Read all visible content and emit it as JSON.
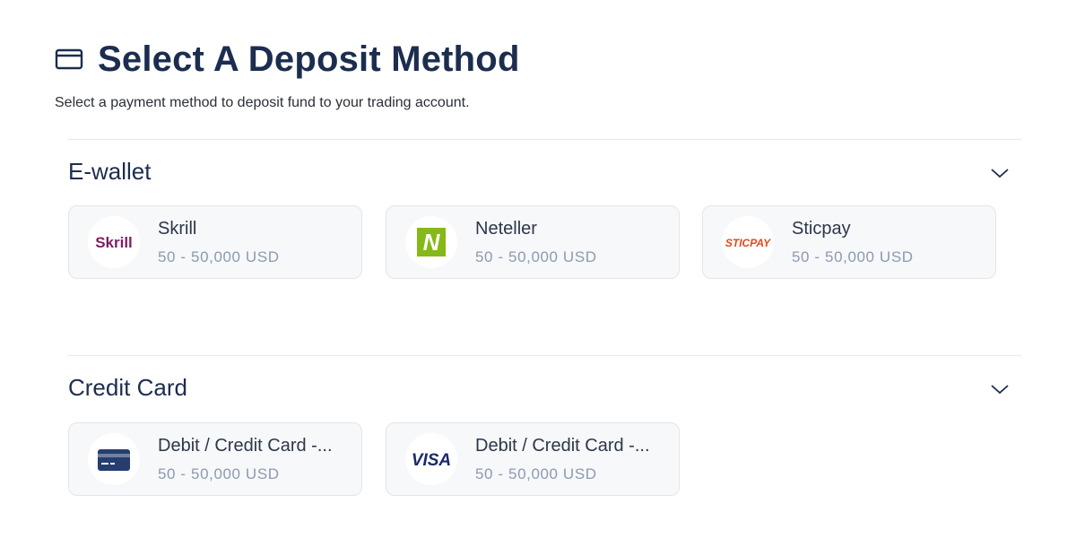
{
  "header": {
    "title": "Select A Deposit Method",
    "subtitle": "Select a payment method to deposit fund to your trading account."
  },
  "sections": [
    {
      "title": "E-wallet",
      "methods": [
        {
          "name": "Skrill",
          "range": "50 - 50,000 USD",
          "logo_text": "Skrill",
          "logo_color": "#7d1d62"
        },
        {
          "name": "Neteller",
          "range": "50 - 50,000 USD",
          "logo_text": "N",
          "logo_color": "#86b817"
        },
        {
          "name": "Sticpay",
          "range": "50 - 50,000 USD",
          "logo_text": "STICPAY",
          "logo_color": "#e2491e"
        }
      ]
    },
    {
      "title": "Credit Card",
      "methods": [
        {
          "name": "Debit / Credit Card -...",
          "range": "50 - 50,000 USD",
          "logo_color": "#263e6e"
        },
        {
          "name": "Debit / Credit Card -...",
          "range": "50 - 50,000 USD",
          "logo_text": "VISA",
          "logo_color": "#1a2a6c"
        }
      ]
    }
  ],
  "colors": {
    "primary": "#1c2d4f",
    "muted": "#8d9ab0",
    "card_bg": "#f7f8fa"
  },
  "icons": {
    "header": "credit-card-outline-icon",
    "section_toggle": "chevron-down-icon"
  }
}
